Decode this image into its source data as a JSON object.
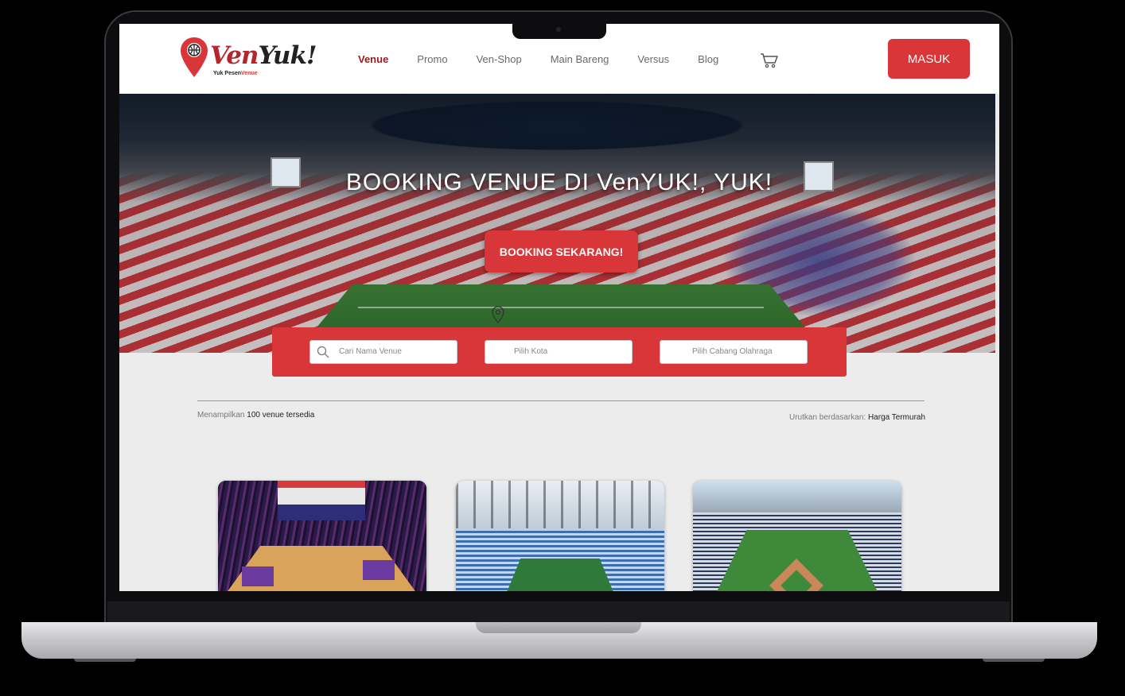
{
  "brand": {
    "name_part1": "Ven",
    "name_part2": "Yuk!",
    "tagline_part1": "Yuk Pesen",
    "tagline_part2": "Venue"
  },
  "nav": {
    "items": [
      {
        "label": "Venue",
        "active": true
      },
      {
        "label": "Promo",
        "active": false
      },
      {
        "label": "Ven-Shop",
        "active": false
      },
      {
        "label": "Main Bareng",
        "active": false
      },
      {
        "label": "Versus",
        "active": false
      },
      {
        "label": "Blog",
        "active": false
      }
    ],
    "login_label": "MASUK"
  },
  "hero": {
    "title": "BOOKING VENUE DI VenYUK!, YUK!",
    "cta_label": "BOOKING SEKARANG!"
  },
  "search": {
    "venue_placeholder": "Cari Nama Venue",
    "city_placeholder": "Pilih Kota",
    "sport_placeholder": "Pilih Cabang Olahraga"
  },
  "results": {
    "showing_prefix": "Menampilkan",
    "showing_count": "100 venue tersedia",
    "sort_prefix": "Urutkan berdasarkan:",
    "sort_value": "Harga Termurah"
  },
  "colors": {
    "accent": "#d9363a",
    "active_nav": "#9a1b1f"
  },
  "icons": [
    "location-pin-logo-icon",
    "cart-icon",
    "search-icon",
    "location-pin-icon"
  ]
}
